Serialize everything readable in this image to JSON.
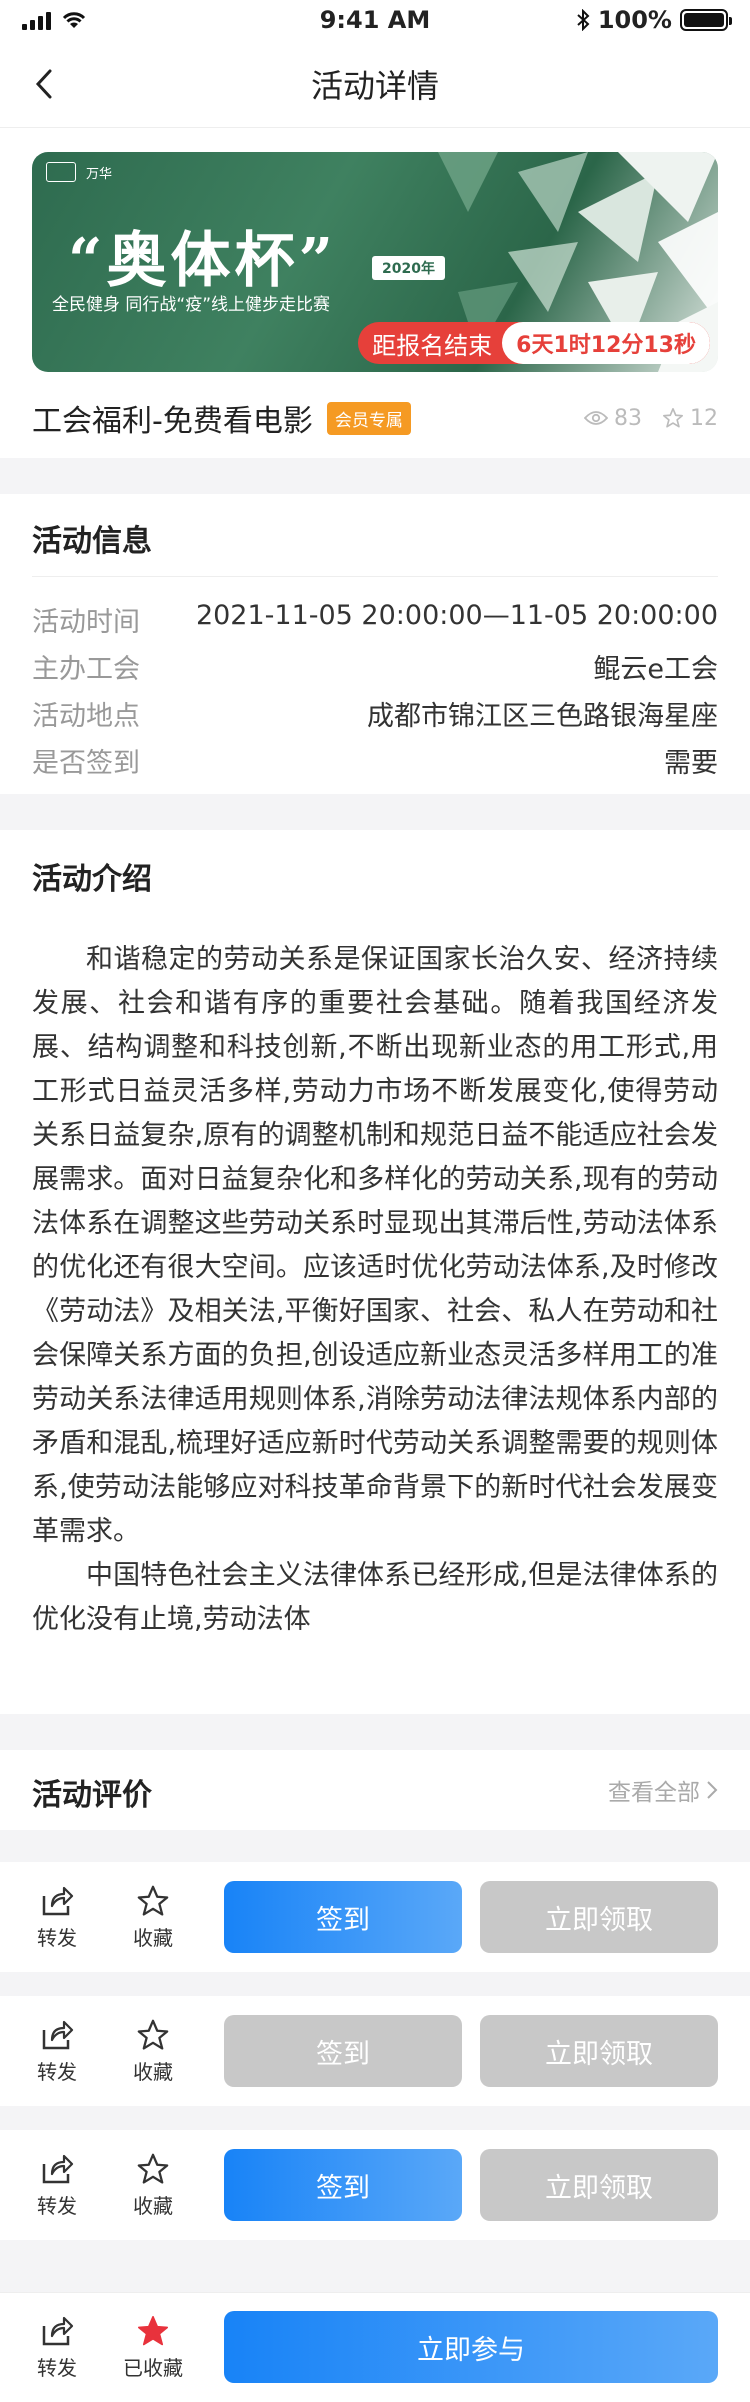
{
  "status": {
    "time": "9:41 AM",
    "battery": "100%"
  },
  "nav": {
    "title": "活动详情"
  },
  "banner": {
    "title": "“奥体杯”",
    "year": "2020年",
    "subtitle": "全民健身 同行战“疫”线上健步走比赛",
    "logo_text": "万华",
    "countdown_label": "距报名结束",
    "countdown_time": "6天1时12分13秒"
  },
  "activity": {
    "title": "工会福利-免费看电影",
    "badge": "会员专属",
    "views": "83",
    "favorites": "12"
  },
  "info": {
    "heading": "活动信息",
    "rows": [
      {
        "label": "活动时间",
        "value": "2021-11-05 20:00:00—11-05 20:00:00"
      },
      {
        "label": "主办工会",
        "value": "鲲云e工会"
      },
      {
        "label": "活动地点",
        "value": "成都市锦江区三色路银海星座"
      },
      {
        "label": "是否签到",
        "value": "需要"
      }
    ]
  },
  "intro": {
    "heading": "活动介绍",
    "paragraphs": [
      "和谐稳定的劳动关系是保证国家长治久安、经济持续发展、社会和谐有序的重要社会基础。随着我国经济发展、结构调整和科技创新,不断出现新业态的用工形式,用工形式日益灵活多样,劳动力市场不断发展变化,使得劳动关系日益复杂,原有的调整机制和规范日益不能适应社会发展需求。面对日益复杂化和多样化的劳动关系,现有的劳动法体系在调整这些劳动关系时显现出其滞后性,劳动法体系的优化还有很大空间。应该适时优化劳动法体系,及时修改《劳动法》及相关法,平衡好国家、社会、私人在劳动和社会保障关系方面的负担,创设适应新业态灵活多样用工的准劳动关系法律适用规则体系,消除劳动法律法规体系内部的矛盾和混乱,梳理好适应新时代劳动关系调整需要的规则体系,使劳动法能够应对科技革命背景下的新时代社会发展变革需求。",
      "中国特色社会主义法律体系已经形成,但是法律体系的优化没有止境,劳动法体"
    ]
  },
  "review": {
    "heading": "活动评价",
    "view_all": "查看全部"
  },
  "action_bars": [
    {
      "share": "转发",
      "collect": "收藏",
      "btn1": "签到",
      "btn2": "立即领取"
    },
    {
      "share": "转发",
      "collect": "收藏",
      "btn1": "签到",
      "btn2": "立即领取"
    },
    {
      "share": "转发",
      "collect": "收藏",
      "btn1": "签到",
      "btn2": "立即领取"
    }
  ],
  "bottom_bar": {
    "share": "转发",
    "collect": "已收藏",
    "main": "立即参与"
  },
  "colors": {
    "primary": "#1883f7",
    "danger": "#e6403a",
    "badge": "#f59a23",
    "disabled": "#c8c8c8",
    "star_active": "#e8323c"
  }
}
